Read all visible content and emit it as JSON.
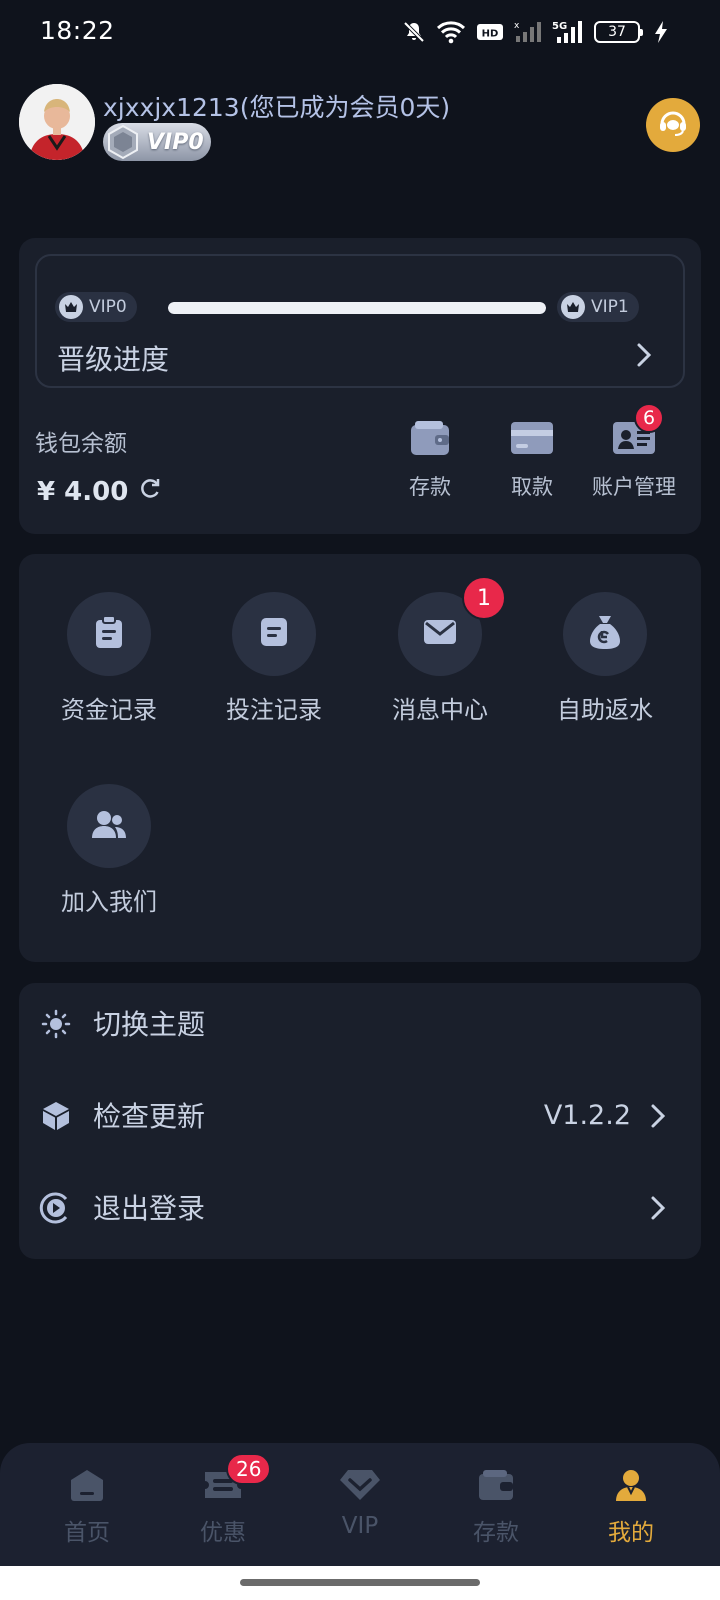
{
  "status_bar": {
    "time": "18:22",
    "network": "5G",
    "battery": "37",
    "icons": [
      "mute-bell-icon",
      "wifi-icon",
      "hd-icon",
      "signal-icon",
      "signal-5g-icon",
      "battery-icon",
      "charging-icon"
    ]
  },
  "profile": {
    "username": "xjxxjx1213(您已成为会员0天)",
    "vip_badge": "VIP0",
    "support_icon": "headset-icon"
  },
  "wallet": {
    "current_level": "VIP0",
    "next_level": "VIP1",
    "progress_fraction": 1.0,
    "progress_label": "晋级进度",
    "balance_label": "钱包余额",
    "balance_value": "¥ 4.00",
    "actions": [
      {
        "label": "存款",
        "icon": "wallet-icon"
      },
      {
        "label": "取款",
        "icon": "card-icon"
      },
      {
        "label": "账户管理",
        "icon": "id-card-icon",
        "badge": "6"
      }
    ]
  },
  "menu": {
    "items": [
      {
        "label": "资金记录",
        "icon": "clipboard-icon"
      },
      {
        "label": "投注记录",
        "icon": "document-icon"
      },
      {
        "label": "消息中心",
        "icon": "mail-icon",
        "badge": "1"
      },
      {
        "label": "自助返水",
        "icon": "money-bag-icon"
      },
      {
        "label": "加入我们",
        "icon": "users-icon"
      }
    ]
  },
  "settings": {
    "rows": [
      {
        "label": "切换主题",
        "icon": "sun-icon"
      },
      {
        "label": "检查更新",
        "icon": "cube-icon",
        "value": "V1.2.2"
      },
      {
        "label": "退出登录",
        "icon": "logout-icon"
      }
    ]
  },
  "bottom_nav": {
    "items": [
      {
        "label": "首页",
        "icon": "home-icon"
      },
      {
        "label": "优惠",
        "icon": "ticket-icon",
        "badge": "26"
      },
      {
        "label": "VIP",
        "icon": "diamond-icon"
      },
      {
        "label": "存款",
        "icon": "wallet-icon"
      },
      {
        "label": "我的",
        "icon": "user-icon",
        "active": true
      }
    ]
  },
  "colors": {
    "background": "#0f131c",
    "card": "#1a1f2b",
    "accent": "#e3aa3c",
    "badge": "#e8284a",
    "text": "#c9d2e3"
  }
}
